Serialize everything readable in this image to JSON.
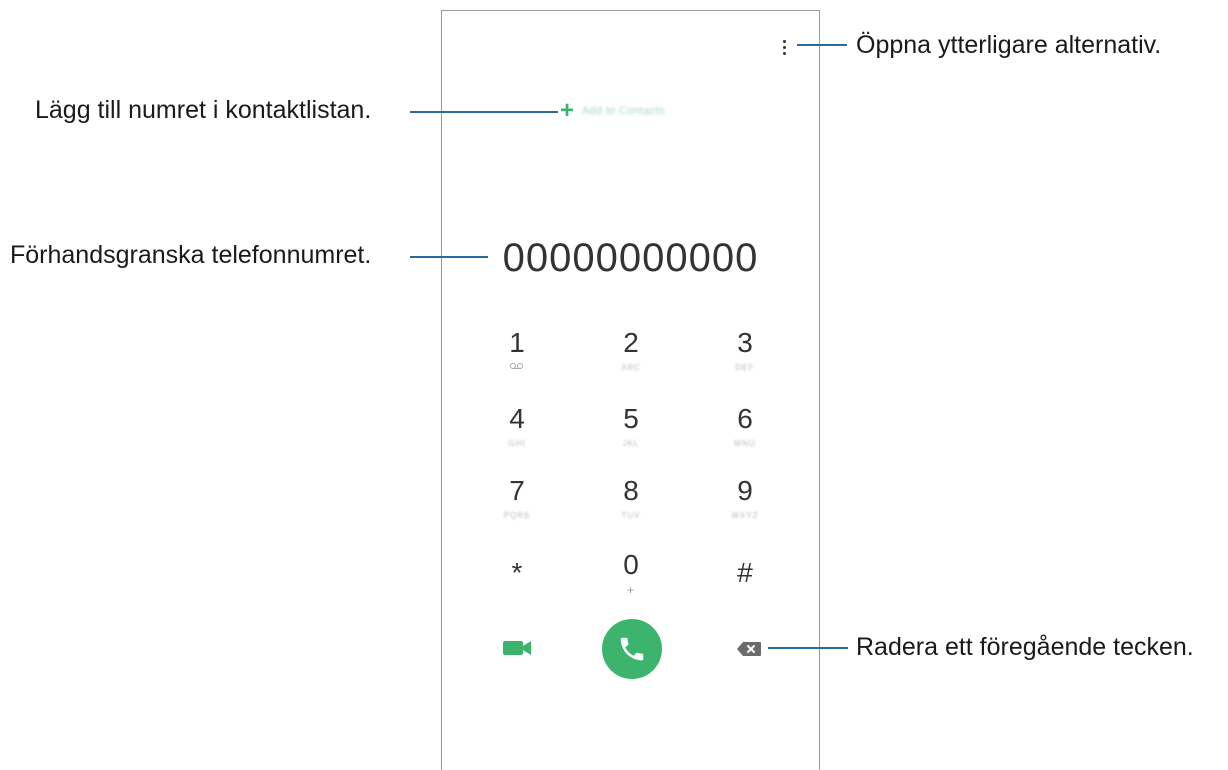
{
  "dialer": {
    "add_to_contacts_label": "Add to Contacts",
    "number_display": "00000000000",
    "keys": [
      {
        "digit": "1",
        "letters": ""
      },
      {
        "digit": "2",
        "letters": "ABC"
      },
      {
        "digit": "3",
        "letters": "DEF"
      },
      {
        "digit": "4",
        "letters": "GHI"
      },
      {
        "digit": "5",
        "letters": "JKL"
      },
      {
        "digit": "6",
        "letters": "MNO"
      },
      {
        "digit": "7",
        "letters": "PQRS"
      },
      {
        "digit": "8",
        "letters": "TUV"
      },
      {
        "digit": "9",
        "letters": "WXYZ"
      },
      {
        "digit": "*",
        "letters": ""
      },
      {
        "digit": "0",
        "letters": "+"
      },
      {
        "digit": "#",
        "letters": ""
      }
    ],
    "icons": {
      "more": "more-options-icon",
      "add": "plus-icon",
      "voicemail": "voicemail-icon",
      "video": "video-call-icon",
      "call": "phone-icon",
      "delete": "backspace-icon"
    },
    "accent_color": "#3db46d"
  },
  "callouts": {
    "more_options": "Öppna ytterligare alternativ.",
    "add_contact": "Lägg till numret i kontaktlistan.",
    "preview_number": "Förhandsgranska telefonnumret.",
    "delete_char": "Radera ett föregående tecken."
  }
}
